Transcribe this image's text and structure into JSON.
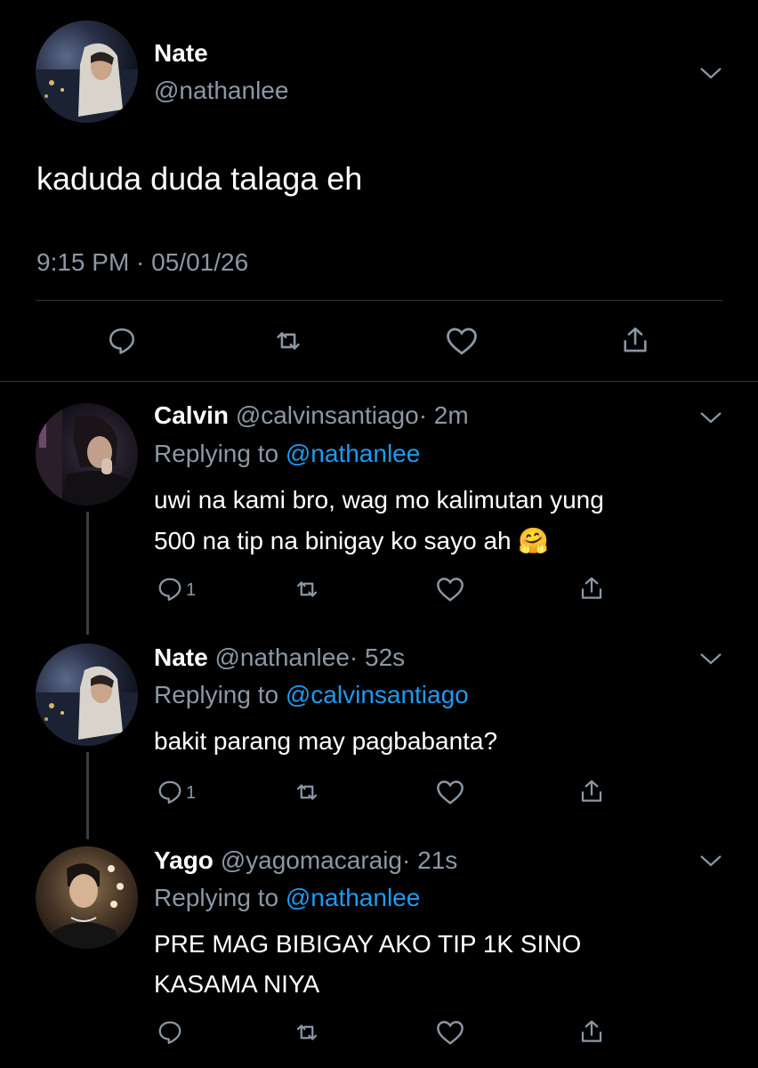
{
  "main_tweet": {
    "name": "Nate",
    "handle": "@nathanlee",
    "text": "kaduda duda talaga eh",
    "timestamp": "9:15 PM · 05/01/26"
  },
  "replies": [
    {
      "name": "Calvin",
      "handle": "@calvinsantiago",
      "time": "· 2m",
      "replying_prefix": "Replying to",
      "replying_to": "@nathanlee",
      "text_line1": "uwi na kami bro, wag mo kalimutan yung",
      "text_line2": "500 na tip na binigay ko sayo ah 🤗",
      "reply_count": "1"
    },
    {
      "name": "Nate",
      "handle": "@nathanlee",
      "time": "· 52s",
      "replying_prefix": "Replying to",
      "replying_to": "@calvinsantiago",
      "text_line1": "bakit parang may pagbabanta?",
      "reply_count": "1"
    },
    {
      "name": "Yago",
      "handle": "@yagomacaraig",
      "time": "· 21s",
      "replying_prefix": "Replying to",
      "replying_to": "@nathanlee",
      "text_line1": "PRE MAG BIBIGAY AKO TIP 1K SINO",
      "text_line2": "KASAMA NIYA",
      "reply_count": ""
    }
  ],
  "colors": {
    "background": "#000000",
    "muted": "#8b98a5",
    "link": "#1d9bf0",
    "divider": "#2f3336"
  },
  "icons": [
    "chevron-down-icon",
    "reply-icon",
    "retweet-icon",
    "like-icon",
    "share-icon"
  ]
}
